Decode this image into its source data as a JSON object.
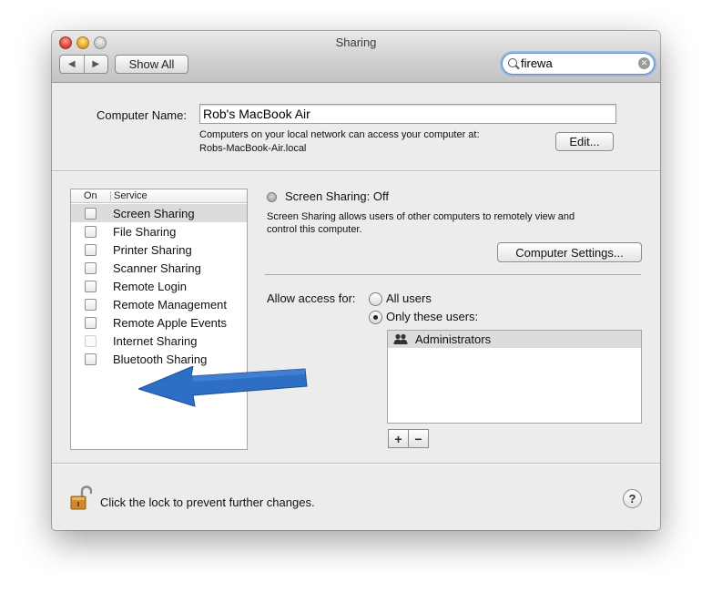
{
  "window": {
    "title": "Sharing"
  },
  "toolbar": {
    "back_glyph": "◀",
    "forward_glyph": "▶",
    "show_all_label": "Show All",
    "search_value": "firewa",
    "search_clear_glyph": "✕"
  },
  "computer": {
    "name_label": "Computer Name:",
    "name_value": "Rob's MacBook Air",
    "network_note": "Computers on your local network can access your computer at:",
    "local_address": "Robs-MacBook-Air.local",
    "edit_label": "Edit..."
  },
  "services": {
    "header_on": "On",
    "header_service": "Service",
    "items": [
      {
        "label": "Screen Sharing",
        "checked": false,
        "selected": true,
        "enabled": true
      },
      {
        "label": "File Sharing",
        "checked": false,
        "selected": false,
        "enabled": true
      },
      {
        "label": "Printer Sharing",
        "checked": false,
        "selected": false,
        "enabled": true
      },
      {
        "label": "Scanner Sharing",
        "checked": false,
        "selected": false,
        "enabled": true
      },
      {
        "label": "Remote Login",
        "checked": false,
        "selected": false,
        "enabled": true
      },
      {
        "label": "Remote Management",
        "checked": false,
        "selected": false,
        "enabled": true
      },
      {
        "label": "Remote Apple Events",
        "checked": false,
        "selected": false,
        "enabled": true
      },
      {
        "label": "Internet Sharing",
        "checked": false,
        "selected": false,
        "enabled": false
      },
      {
        "label": "Bluetooth Sharing",
        "checked": false,
        "selected": false,
        "enabled": true
      }
    ]
  },
  "detail": {
    "status": "Screen Sharing: Off",
    "description_line1": "Screen Sharing allows users of other computers to remotely view and",
    "description_line2": "control this computer.",
    "computer_settings_label": "Computer Settings...",
    "allow_access_label": "Allow access for:",
    "option_all_users": "All users",
    "option_only_these": "Only these users:",
    "selected_option": "only_these",
    "users": [
      {
        "name": "Administrators",
        "icon": "group-icon"
      }
    ],
    "add_label": "+",
    "remove_label": "−"
  },
  "footer": {
    "lock_text": "Click the lock to prevent further changes.",
    "help_label": "?"
  },
  "colors": {
    "window_bg": "#ececec",
    "selection_gray": "#dcdcdc",
    "search_focus": "#93b7e6",
    "arrow_blue": "#2d6fc4",
    "lock_gold": "#d08a2c"
  }
}
